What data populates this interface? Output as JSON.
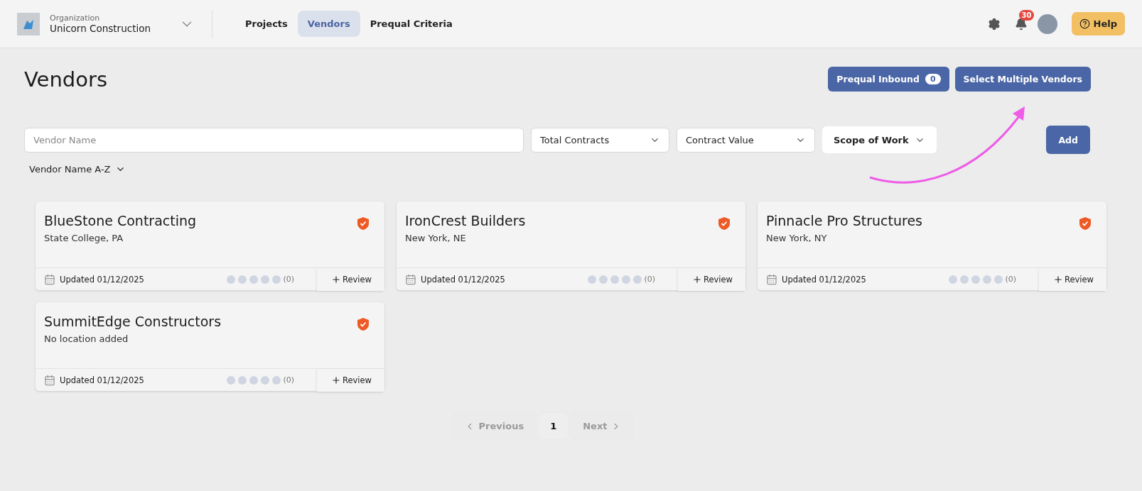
{
  "header": {
    "org_label": "Organization",
    "org_name": "Unicorn Construction",
    "nav": [
      {
        "label": "Projects",
        "selected": false
      },
      {
        "label": "Vendors",
        "selected": true
      },
      {
        "label": "Prequal Criteria",
        "selected": false
      }
    ],
    "notification_count": "30",
    "help": "Help"
  },
  "page": {
    "title": "Vendors",
    "actions": [
      {
        "label": "Prequal Inbound",
        "count": "0"
      },
      {
        "label": "Select Multiple Vendors"
      }
    ]
  },
  "filters": {
    "search": {
      "placeholder": "Vendor Name"
    },
    "dropdowns": [
      {
        "label": "Total Contracts",
        "kind": "select"
      },
      {
        "label": "Contract Value",
        "kind": "select"
      },
      {
        "label": "Scope of Work",
        "kind": "chip"
      }
    ],
    "add": "Add",
    "sort": "Vendor Name A-Z"
  },
  "vendors": [
    {
      "name": "BlueStone Contracting",
      "location": "State College, PA",
      "verified": true,
      "updated": "Updated 01/12/2025",
      "stars": 0,
      "review_count": "(0)",
      "review": "Review"
    },
    {
      "name": "IronCrest Builders",
      "location": "New York, NE",
      "verified": true,
      "updated": "Updated 01/12/2025",
      "stars": 0,
      "review_count": "(0)",
      "review": "Review"
    },
    {
      "name": "Pinnacle Pro Structures",
      "location": "New York, NY",
      "verified": true,
      "updated": "Updated 01/12/2025",
      "stars": 0,
      "review_count": "(0)",
      "review": "Review"
    },
    {
      "name": "SummitEdge Constructors",
      "location": "No location added",
      "verified": true,
      "updated": "Updated 01/12/2025",
      "stars": 0,
      "review_count": "(0)",
      "review": "Review"
    }
  ],
  "pagination": {
    "previous": {
      "label": "Previous",
      "disabled": true
    },
    "pages": [
      {
        "label": "1",
        "selected": true
      }
    ],
    "next": {
      "label": "Next",
      "disabled": true
    }
  },
  "annotation": {
    "arrow": true
  }
}
